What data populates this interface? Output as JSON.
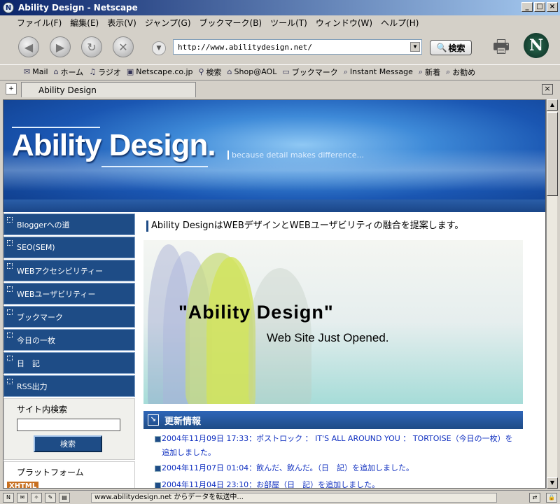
{
  "window": {
    "title": "Ability Design - Netscape"
  },
  "menu": [
    "ファイル(F)",
    "編集(E)",
    "表示(V)",
    "ジャンプ(G)",
    "ブックマーク(B)",
    "ツール(T)",
    "ウィンドウ(W)",
    "ヘルプ(H)"
  ],
  "toolbar": {
    "url": "http://www.abilitydesign.net/",
    "search_label": "検索"
  },
  "personal_bar": [
    "Mail",
    "ホーム",
    "ラジオ",
    "Netscape.co.jp",
    "検索",
    "Shop@AOL",
    "ブックマーク",
    "Instant Message",
    "新着",
    "お勧め"
  ],
  "tab": {
    "label": "Ability Design"
  },
  "site": {
    "logo": "Ability Design.",
    "tagline": "because detail makes difference...",
    "nav": [
      "Bloggerへの道",
      "SEO(SEM)",
      "WEBアクセシビリティー",
      "WEBユーザビリティー",
      "ブックマーク",
      "今日の一枚",
      "日　記",
      "RSS出力"
    ],
    "search": {
      "label": "サイト内検索",
      "button": "検索"
    },
    "platform": {
      "label": "プラットフォーム",
      "badge": "XHTML"
    },
    "intro": "Ability DesignはWEBデザインとWEBユーザビリティの融合を提案します。",
    "hero": {
      "title": "\"Ability Design\"",
      "subtitle": "Web Site Just Opened."
    },
    "news": {
      "heading": "更新情報",
      "items": [
        "2004年11月09日 17:33：ポストロック ： IT'S ALL AROUND YOU ： TORTOISE（今日の一枚）を追加しました。",
        "2004年11月07日 01:04：飲んだ、飲んだ。（日　記）を追加しました。",
        "2004年11月04日 23:10：お部屋（日　記）を追加しました。"
      ]
    }
  },
  "status": {
    "message": "www.abilitydesign.net からデータを転送中..."
  }
}
